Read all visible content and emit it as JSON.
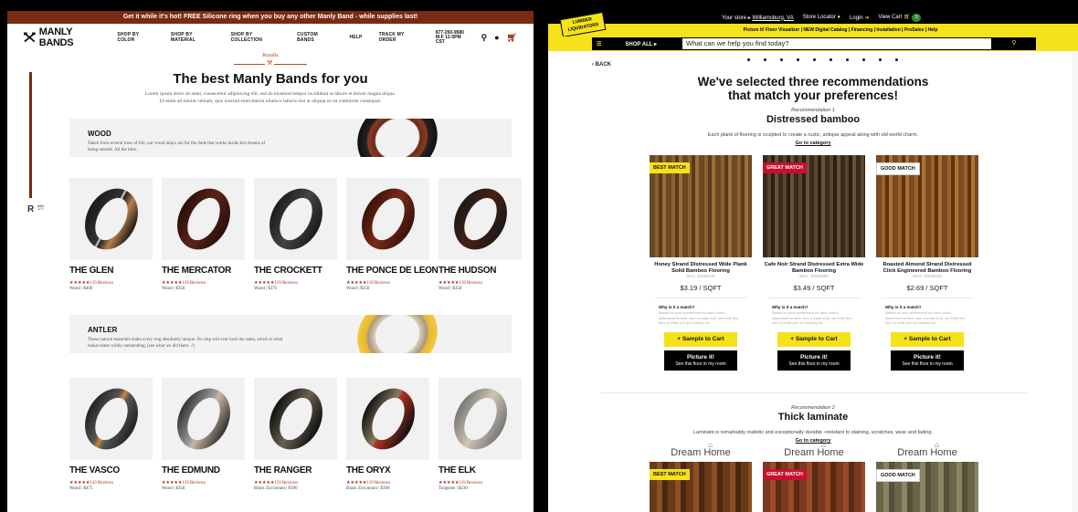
{
  "manly": {
    "promo": "Get it while it's hot! FREE Silicone ring when you buy any other Manly Band - while supplies last!",
    "logo": "MANLY BANDS",
    "nav": [
      "SHOP BY COLOR",
      "SHOP BY MATERIAL",
      "SHOP BY COLLECTION",
      "CUSTOM BANDS",
      "HELP",
      "TRACK MY ORDER"
    ],
    "phone": "877-250-9580",
    "hours": "M-F 12-5PM CST",
    "kicker": "Results",
    "title": "The best Manly Bands for you",
    "subtitle1": "Lorem ipsum dolor sit amet, consectetur adipisicing elit, sed do eiusmod tempor incididunt ut labore et dolore magna aliqua.",
    "subtitle2": "Ut enim ad minim veniam, quis nostrud exercitation ullamco laboris nisi ut aliquip ex ea commodo consequat.",
    "side_letter": "R",
    "side_num": "10",
    "categories": [
      {
        "name": "WOOD",
        "desc": "Taken from several trees of life, our wood inlays are for the dude that works inside but dreams of being outside. All the time.",
        "products": [
          {
            "name": "THE GLEN",
            "reviews": "★★★★★119 Reviews",
            "meta": "Wood | $400"
          },
          {
            "name": "THE MERCATOR",
            "reviews": "★★★★★119 Reviews",
            "meta": "Wood | $350"
          },
          {
            "name": "THE CROCKETT",
            "reviews": "★★★★★119 Reviews",
            "meta": "Wood | $375"
          },
          {
            "name": "THE PONCE DE LEON",
            "reviews": "★★★★★119 Reviews",
            "meta": "Wood | $350"
          },
          {
            "name": "THE HUDSON",
            "reviews": "★★★★★119 Reviews",
            "meta": "Wood | $350"
          }
        ]
      },
      {
        "name": "ANTLER",
        "desc": "These natural materials make every ring absolutely unique. No ring will ever look the same, which is what makes them wildly outstanding. (see what we did there...!)",
        "products": [
          {
            "name": "THE VASCO",
            "reviews": "★★★★★119 Reviews",
            "meta": "Wood | $475"
          },
          {
            "name": "THE EDMUND",
            "reviews": "★★★★★119 Reviews",
            "meta": "Wood | $350"
          },
          {
            "name": "THE RANGER",
            "reviews": "★★★★★119 Reviews",
            "meta": "Black Zirconium | $390"
          },
          {
            "name": "THE ORYX",
            "reviews": "★★★★★119 Reviews",
            "meta": "Black Zirconium | $390"
          },
          {
            "name": "THE ELK",
            "reviews": "★★★★★119 Reviews",
            "meta": "Tungsten | $230"
          }
        ]
      }
    ]
  },
  "ll": {
    "topbar": {
      "store_prefix": "Your store ▸",
      "store": "Williamsburg, VA",
      "locator": "Store Locator",
      "login": "Login",
      "cart": "View Cart",
      "cart_count": "0"
    },
    "logo": "LUMBER LIQUIDATORS",
    "yellowbar": "Picture It! Floor Visualizer  |  NEW Digital Catalog  |  Financing  |  Installation  |  ProSales  |  Help",
    "shop_all": "SHOP ALL ▸",
    "search_placeholder": "What can we help you find today?",
    "back": "BACK",
    "title1": "We've selected three recommendations",
    "title2": "that match your preferences!",
    "rec1": {
      "kicker": "Recommendation 1",
      "name": "Distressed bamboo",
      "desc": "Each plank of flooring is sculpted to create a rustic, antique appeal along with old-world charm.",
      "link": "Go to category",
      "cards": [
        {
          "badge": "BEST MATCH",
          "name": "Honey Strand Distressed Wide Plank Solid Bamboo Flooring",
          "sku": "SKU: 10029148",
          "price": "$3.19 /  SQFT",
          "why": "Why is it a match?",
          "why_text": "Based on your preference for dark colors, distressed texture, and a rustic look, we think this floor is what you are looking for.",
          "sample": "+ Sample to Cart",
          "picture": "Picture it!",
          "picture_sub": "See this floor in my room"
        },
        {
          "badge": "GREAT MATCH",
          "name": "Cafe Noir Strand Distressed Extra Wide Bamboo Flooring",
          "sku": "SKU: 10062986",
          "price": "$3.49 /  SQFT",
          "why": "Why is it a match?",
          "why_text": "Based on your preference for dark colors, distressed texture, and a rustic look, we think this floor is what you are looking for.",
          "sample": "+ Sample to Cart",
          "picture": "Picture it!",
          "picture_sub": "See this floor in my room"
        },
        {
          "badge": "GOOD MATCH",
          "name": "Roasted Almond Strand Distressed Click Engineered Bamboo Flooring",
          "sku": "SKU: 10029182",
          "price": "$2.69 /  SQFT",
          "why": "Why is it a match?",
          "why_text": "Based on your preference for dark colors, distressed texture, and a rustic look, we think this floor is what you are looking for.",
          "sample": "+ Sample to Cart",
          "picture": "Picture it!",
          "picture_sub": "See this floor in my room"
        }
      ]
    },
    "rec2": {
      "kicker": "Recommendation 2",
      "name": "Thick laminate",
      "desc": "Laminate is remarkably realistic and exceptionally durable -resistant to staining, scratches, wear and fading.",
      "link": "Go to category",
      "brand": "Dream Home",
      "badges": [
        "BEST MATCH",
        "GREAT MATCH",
        "GOOD MATCH"
      ]
    }
  },
  "colors": {
    "manly_brown": "#7a2a12",
    "ll_yellow": "#f5e21a",
    "ll_red": "#c8102e"
  }
}
